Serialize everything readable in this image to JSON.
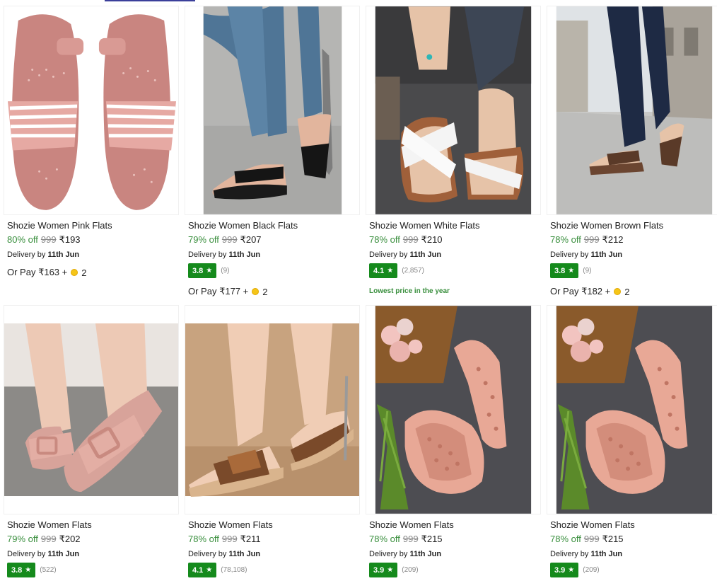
{
  "products": [
    {
      "title": "Shozie Women Pink Flats",
      "discount": "80% off",
      "mrp": "999",
      "price": "₹193",
      "delivery_prefix": "Delivery by",
      "delivery_date": "11th Jun",
      "orpay_text": "Or Pay ₹163 +",
      "orpay_coins": "2"
    },
    {
      "title": "Shozie Women Black Flats",
      "discount": "79% off",
      "mrp": "999",
      "price": "₹207",
      "delivery_prefix": "Delivery by",
      "delivery_date": "11th Jun",
      "rating": "3.8",
      "rating_count": "(9)",
      "orpay_text": "Or Pay ₹177 +",
      "orpay_coins": "2"
    },
    {
      "title": "Shozie Women White Flats",
      "discount": "78% off",
      "mrp": "999",
      "price": "₹210",
      "delivery_prefix": "Delivery by",
      "delivery_date": "11th Jun",
      "rating": "4.1",
      "rating_count": "(2,857)",
      "highlight": "Lowest price in the year"
    },
    {
      "title": "Shozie Women Brown Flats",
      "discount": "78% off",
      "mrp": "999",
      "price": "₹212",
      "delivery_prefix": "Delivery by",
      "delivery_date": "11th Jun",
      "rating": "3.8",
      "rating_count": "(9)",
      "orpay_text": "Or Pay ₹182 +",
      "orpay_coins": "2"
    },
    {
      "title": "Shozie Women Flats",
      "discount": "79% off",
      "mrp": "999",
      "price": "₹202",
      "delivery_prefix": "Delivery by",
      "delivery_date": "11th Jun",
      "rating": "3.8",
      "rating_count": "(522)"
    },
    {
      "title": "Shozie Women Flats",
      "discount": "78% off",
      "mrp": "999",
      "price": "₹211",
      "delivery_prefix": "Delivery by",
      "delivery_date": "11th Jun",
      "rating": "4.1",
      "rating_count": "(78,108)"
    },
    {
      "title": "Shozie Women Flats",
      "discount": "78% off",
      "mrp": "999",
      "price": "₹215",
      "delivery_prefix": "Delivery by",
      "delivery_date": "11th Jun",
      "rating": "3.9",
      "rating_count": "(209)"
    },
    {
      "title": "Shozie Women Flats",
      "discount": "78% off",
      "mrp": "999",
      "price": "₹215",
      "delivery_prefix": "Delivery by",
      "delivery_date": "11th Jun",
      "rating": "3.9",
      "rating_count": "(209)"
    }
  ],
  "icons": {
    "rating_star": "star-icon",
    "supercoin": "coin-icon"
  },
  "colors": {
    "discount_green": "#388e3c",
    "rating_badge": "#158a1c",
    "mrp_grey": "#878787",
    "coin_gold": "#f5c518"
  }
}
